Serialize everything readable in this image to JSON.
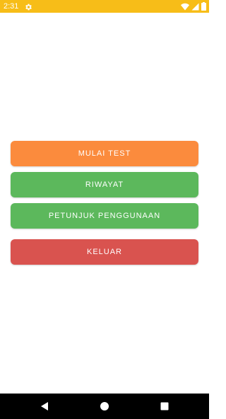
{
  "status_bar": {
    "time": "2:31",
    "background": "#f7bd18",
    "icons": [
      "settings-gear-icon",
      "wifi-icon",
      "cellular-signal-icon",
      "battery-icon"
    ]
  },
  "menu": {
    "start_label": "MULAI TEST",
    "history_label": "RIWAYAT",
    "guide_label": "PETUNJUK PENGGUNAAN",
    "exit_label": "KELUAR"
  },
  "colors": {
    "start": "#fb8b3d",
    "history": "#5cb85c",
    "guide": "#5cb85c",
    "exit": "#d9534f"
  },
  "nav_bar": {
    "icons": [
      "back-icon",
      "home-icon",
      "recent-apps-icon"
    ]
  }
}
